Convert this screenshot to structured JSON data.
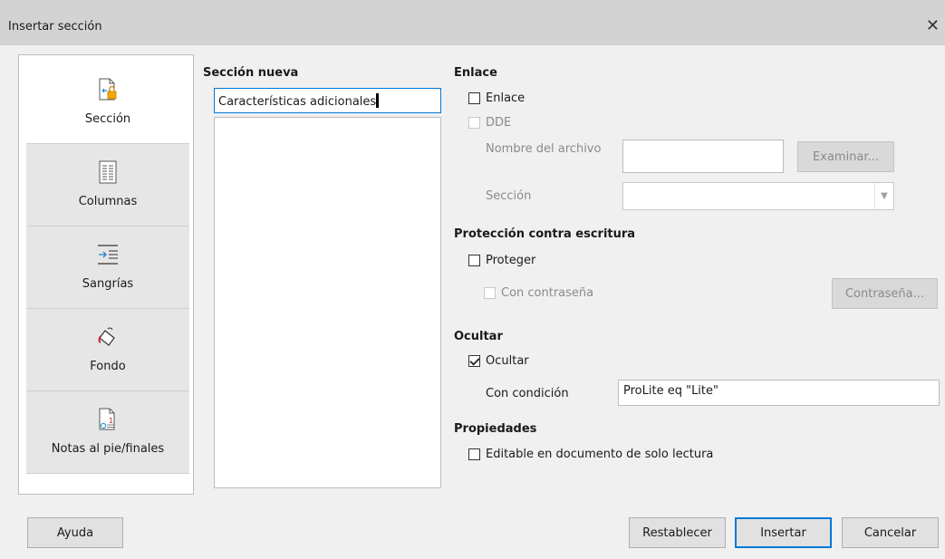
{
  "window": {
    "title": "Insertar sección",
    "close_icon": "close-icon"
  },
  "sidebar": {
    "tabs": [
      {
        "label": "Sección",
        "icon": "section-lock-icon",
        "active": true
      },
      {
        "label": "Columnas",
        "icon": "columns-icon",
        "active": false
      },
      {
        "label": "Sangrías",
        "icon": "indent-icon",
        "active": false
      },
      {
        "label": "Fondo",
        "icon": "paint-bucket-icon",
        "active": false
      },
      {
        "label": "Notas al pie/finales",
        "icon": "footnote-icon",
        "active": false
      }
    ]
  },
  "new_section": {
    "heading": "Sección nueva",
    "name_value": "Características adicionales"
  },
  "link": {
    "heading": "Enlace",
    "link_checkbox": "Enlace",
    "dde_checkbox": "DDE",
    "filename_label": "Nombre del archivo",
    "browse_button": "Examinar...",
    "section_label": "Sección"
  },
  "protection": {
    "heading": "Protección contra escritura",
    "protect_checkbox": "Proteger",
    "password_checkbox": "Con contraseña",
    "password_button": "Contraseña..."
  },
  "hide": {
    "heading": "Ocultar",
    "hide_checkbox": "Ocultar",
    "hide_checked": true,
    "condition_label": "Con condición",
    "condition_value": "ProLite eq \"Lite\""
  },
  "properties": {
    "heading": "Propiedades",
    "editable_checkbox": "Editable en documento de solo lectura"
  },
  "footer": {
    "help": "Ayuda",
    "reset": "Restablecer",
    "insert": "Insertar",
    "cancel": "Cancelar"
  },
  "colors": {
    "accent": "#0078d7",
    "titlebar": "#d3d3d3",
    "background": "#f0f0f0"
  }
}
